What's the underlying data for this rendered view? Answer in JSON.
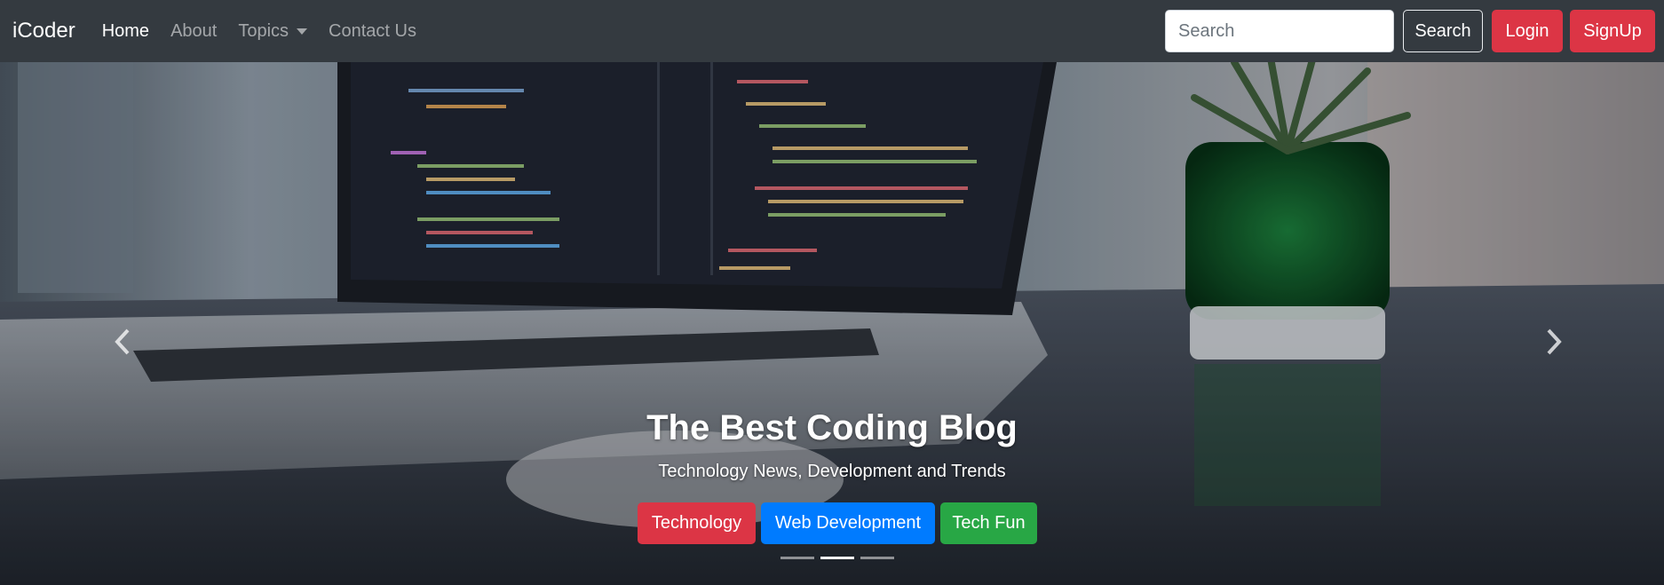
{
  "navbar": {
    "brand": "iCoder",
    "links": [
      "Home",
      "About",
      "Topics",
      "Contact Us"
    ],
    "search_placeholder": "Search",
    "search_button": "Search",
    "login_button": "Login",
    "signup_button": "SignUp"
  },
  "carousel": {
    "title": "The Best Coding Blog",
    "subtitle": "Technology News, Development and Trends",
    "buttons": [
      "Technology",
      "Web Development",
      "Tech Fun"
    ],
    "slide_count": 3,
    "active_slide": 2
  },
  "colors": {
    "navbar_bg": "#343a40",
    "danger": "#dc3545",
    "primary": "#007bff",
    "success": "#28a745"
  },
  "icons": [
    "chevron-left-icon",
    "chevron-right-icon",
    "caret-down-icon"
  ]
}
